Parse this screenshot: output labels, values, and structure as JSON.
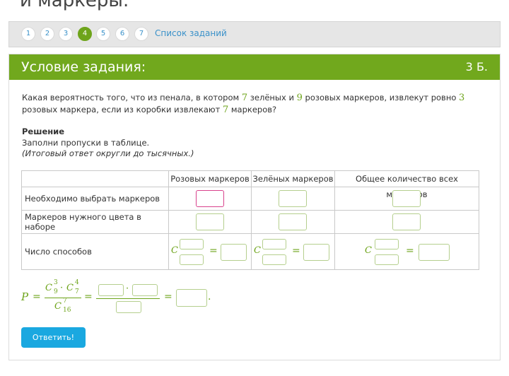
{
  "page": {
    "heading_fragment": "й маркеры."
  },
  "nav": {
    "steps": [
      "1",
      "2",
      "3",
      "4",
      "5",
      "6",
      "7"
    ],
    "active_step": "4",
    "task_list_label": "Список заданий"
  },
  "card": {
    "title": "Условие задания:",
    "points": "3 Б."
  },
  "question": {
    "p1": "Какая вероятность того, что из пенала, в котором ",
    "n_green": "7",
    "p2": " зелёных и ",
    "n_pink": "9",
    "p3": " розовых маркеров, извлекут ровно ",
    "n_pick_pink": "3",
    "p4": " розовых маркера, если из коробки извлекают ",
    "n_total_pick": "7",
    "p5": " маркеров?"
  },
  "solution": {
    "heading": "Решение",
    "instruction": "Заполни пропуски в таблице.",
    "note": "(Итоговый ответ округли до тысячных.)"
  },
  "table": {
    "headers": [
      "Розовых маркеров",
      "Зелёных маркеров",
      "Общее количество всех маркеров"
    ],
    "rows": [
      "Необходимо выбрать маркеров",
      "Маркеров нужного цвета в наборе",
      "Число способов"
    ],
    "combination_letter": "C",
    "equals": "="
  },
  "formula": {
    "p_symbol": "P",
    "equals": "=",
    "c": "C",
    "num1_sup": "3",
    "num1_sub": "9",
    "dot": "·",
    "num2_sup": "4",
    "num2_sub": "7",
    "den_sup": "7",
    "den_sub": "16",
    "period": "."
  },
  "submit_label": "Ответить!",
  "colors": {
    "green": "#71a81d",
    "accent_blue": "#1aa8e0",
    "link_blue": "#3a91c9",
    "input_border": "#b5cf8e",
    "focus_border": "#d8428c"
  }
}
